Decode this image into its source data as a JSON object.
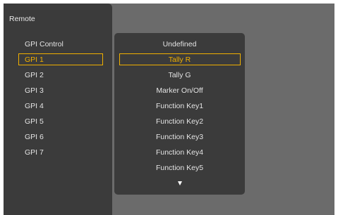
{
  "sidebar": {
    "title": "Remote",
    "items": [
      {
        "label": "GPI Control",
        "selected": false
      },
      {
        "label": "GPI 1",
        "selected": true
      },
      {
        "label": "GPI 2",
        "selected": false
      },
      {
        "label": "GPI 3",
        "selected": false
      },
      {
        "label": "GPI 4",
        "selected": false
      },
      {
        "label": "GPI 5",
        "selected": false
      },
      {
        "label": "GPI 6",
        "selected": false
      },
      {
        "label": "GPI 7",
        "selected": false
      }
    ]
  },
  "dropdown": {
    "options": [
      {
        "label": "Undefined",
        "selected": false
      },
      {
        "label": "Tally R",
        "selected": true
      },
      {
        "label": "Tally G",
        "selected": false
      },
      {
        "label": "Marker On/Off",
        "selected": false
      },
      {
        "label": "Function Key1",
        "selected": false
      },
      {
        "label": "Function Key2",
        "selected": false
      },
      {
        "label": "Function Key3",
        "selected": false
      },
      {
        "label": "Function Key4",
        "selected": false
      },
      {
        "label": "Function Key5",
        "selected": false
      }
    ],
    "scroll_icon": "triangle-down-icon"
  },
  "colors": {
    "background": "#6b6b6b",
    "panel": "#3b3b3b",
    "text": "#e4e4e4",
    "highlight": "#f0b000"
  }
}
